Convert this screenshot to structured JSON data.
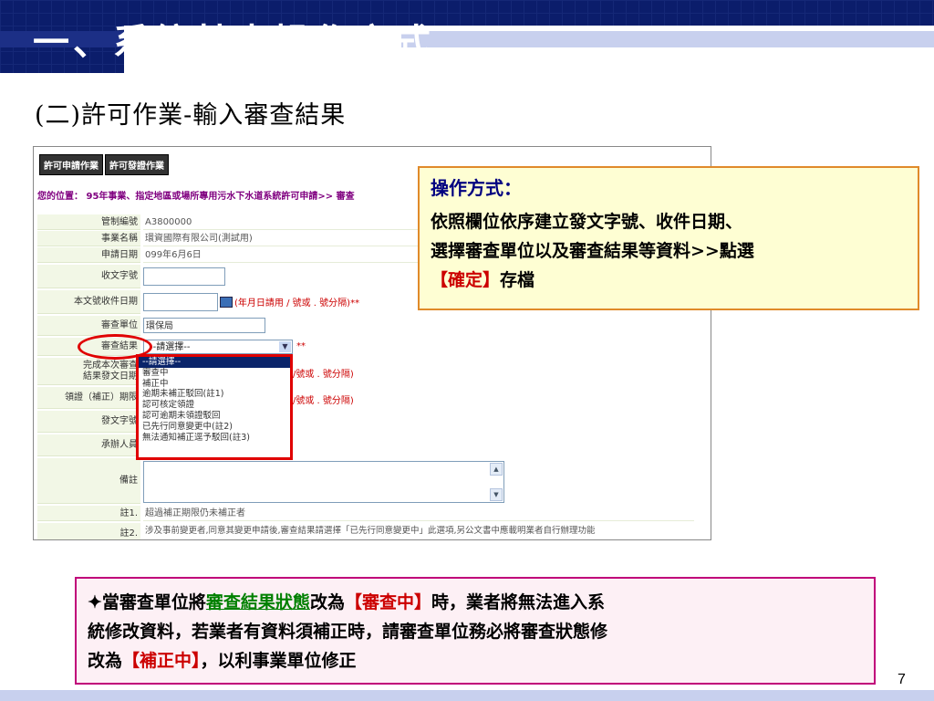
{
  "header": {
    "title": "一、系統基本操作方式"
  },
  "subtitle": "(二)許可作業-輸入審查結果",
  "panel": {
    "tabs": [
      "許可申請作業",
      "許可發證作業"
    ],
    "breadcrumb": "您的位置： 95年事業、指定地區或場所專用污水下水道系統許可申請>> 審查",
    "rows": {
      "control_no": {
        "label": "管制編號",
        "value": "A3800000"
      },
      "business_name": {
        "label": "事業名稱",
        "value": "環資國際有限公司(測試用)"
      },
      "apply_date": {
        "label": "申請日期",
        "value": "099年6月6日"
      },
      "receipt_no": {
        "label": "收文字號"
      },
      "doc_date": {
        "label": "本文號收件日期",
        "hint": "(年月日請用 / 號或 . 號分隔)**"
      },
      "review_unit": {
        "label": "審查單位",
        "value": "環保局"
      },
      "review_result": {
        "label": "審查結果",
        "selected": "--請選擇--",
        "required": "**"
      },
      "complete_date": {
        "label_line1": "完成本次審查",
        "label_line2": "結果發文日期",
        "hint": "/號或 . 號分隔)"
      },
      "deadline": {
        "label": "領證（補正）期限",
        "hint": "/號或 . 號分隔)"
      },
      "send_no": {
        "label": "發文字號"
      },
      "handler": {
        "label": "承辦人員"
      },
      "remark": {
        "label": "備註"
      },
      "note1": {
        "label": "註1.",
        "value": "超過補正期限仍未補正者"
      },
      "note2": {
        "label": "註2.",
        "value": "涉及事前變更者,同意其變更申請後,審查結果請選擇「已先行同意變更中」此選項,另公文書中應載明業者自行辦理功能"
      }
    },
    "dropdown_options": [
      "--請選擇--",
      "審查中",
      "補正中",
      "逾期未補正駁回(註1)",
      "認可核定領證",
      "認可逾期未領證駁回",
      "已先行同意變更中(註2)",
      "無法通知補正逕予駁回(註3)"
    ]
  },
  "callout": {
    "title": "操作方式：",
    "line1": "依照欄位依序建立發文字號、收件日期、",
    "line2": "選擇審查單位以及審查結果等資料>>點選",
    "button_ref": "【確定】",
    "tail": "存檔"
  },
  "note": {
    "prefix": "✦當審查單位將",
    "highlight": "審查結果狀態",
    "mid": "改為",
    "status1": "【審查中】",
    "mid2": "時，業者將無法進入系",
    "line2": "統修改資料，若業者有資料須補正時，請審查單位務必將審查狀態修",
    "line3_pre": "改為",
    "status2": "【補正中】",
    "line3_post": "，以利事業單位修正"
  },
  "page_number": "7",
  "icons": {
    "calendar": "calendar-icon",
    "dropdown": "chevron-down-icon"
  }
}
